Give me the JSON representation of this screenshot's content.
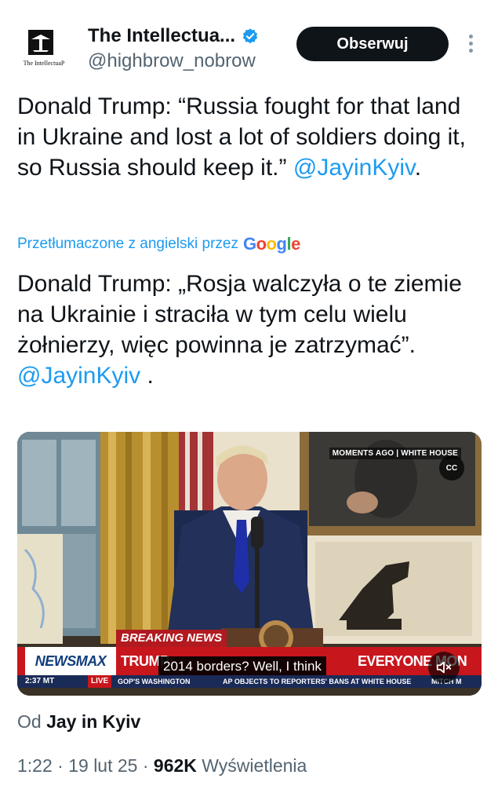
{
  "author": {
    "name": "The Intellectua...",
    "handle": "@highbrow_nobrow",
    "avatar_text": "The IntellectuaP",
    "verified": true
  },
  "follow_label": "Obserwuj",
  "more_icon": "more-vertical-icon",
  "tweet": {
    "text": "Donald Trump: “Russia fought for that land in Ukraine and lost a lot of soldiers doing it, so Russia should keep it.”",
    "mention": "@JayinKyiv",
    "tail": "."
  },
  "translation": {
    "label": "Przetłumaczone z angielski przez",
    "provider": "Google",
    "text": "Donald Trump: „Rosja walczyła o te ziemie na Ukrainie i straciła w tym celu wielu żołnierzy, więc powinna je zatrzymać”.",
    "mention": "@JayinKyiv",
    "tail": " ."
  },
  "video": {
    "tag": "MOMENTS AGO | WHITE HOUSE",
    "cc_label": "CC",
    "breaking": "BREAKING NEWS",
    "network": "NEWSMAX",
    "headline_left": "TRUMP:",
    "headline_right": "EVERYONE MON",
    "caption": "2014 borders? Well, I think",
    "time": "2:37 MT",
    "live": "LIVE",
    "ticker_1": "GOP'S WASHINGTON",
    "ticker_2": "AP OBJECTS TO REPORTERS' BANS AT WHITE HOUSE",
    "ticker_3": "MITCH M"
  },
  "attribution": {
    "prefix": "Od",
    "source": "Jay in Kyiv"
  },
  "meta": {
    "time": "1:22",
    "date": "19 lut 25",
    "views": "962K",
    "views_label": "Wyświetlenia"
  },
  "colors": {
    "link": "#1d9bf0",
    "text": "#0f1419",
    "secondary": "#536471",
    "follow_bg": "#0f1419",
    "newsmax_red": "#c8161d"
  }
}
